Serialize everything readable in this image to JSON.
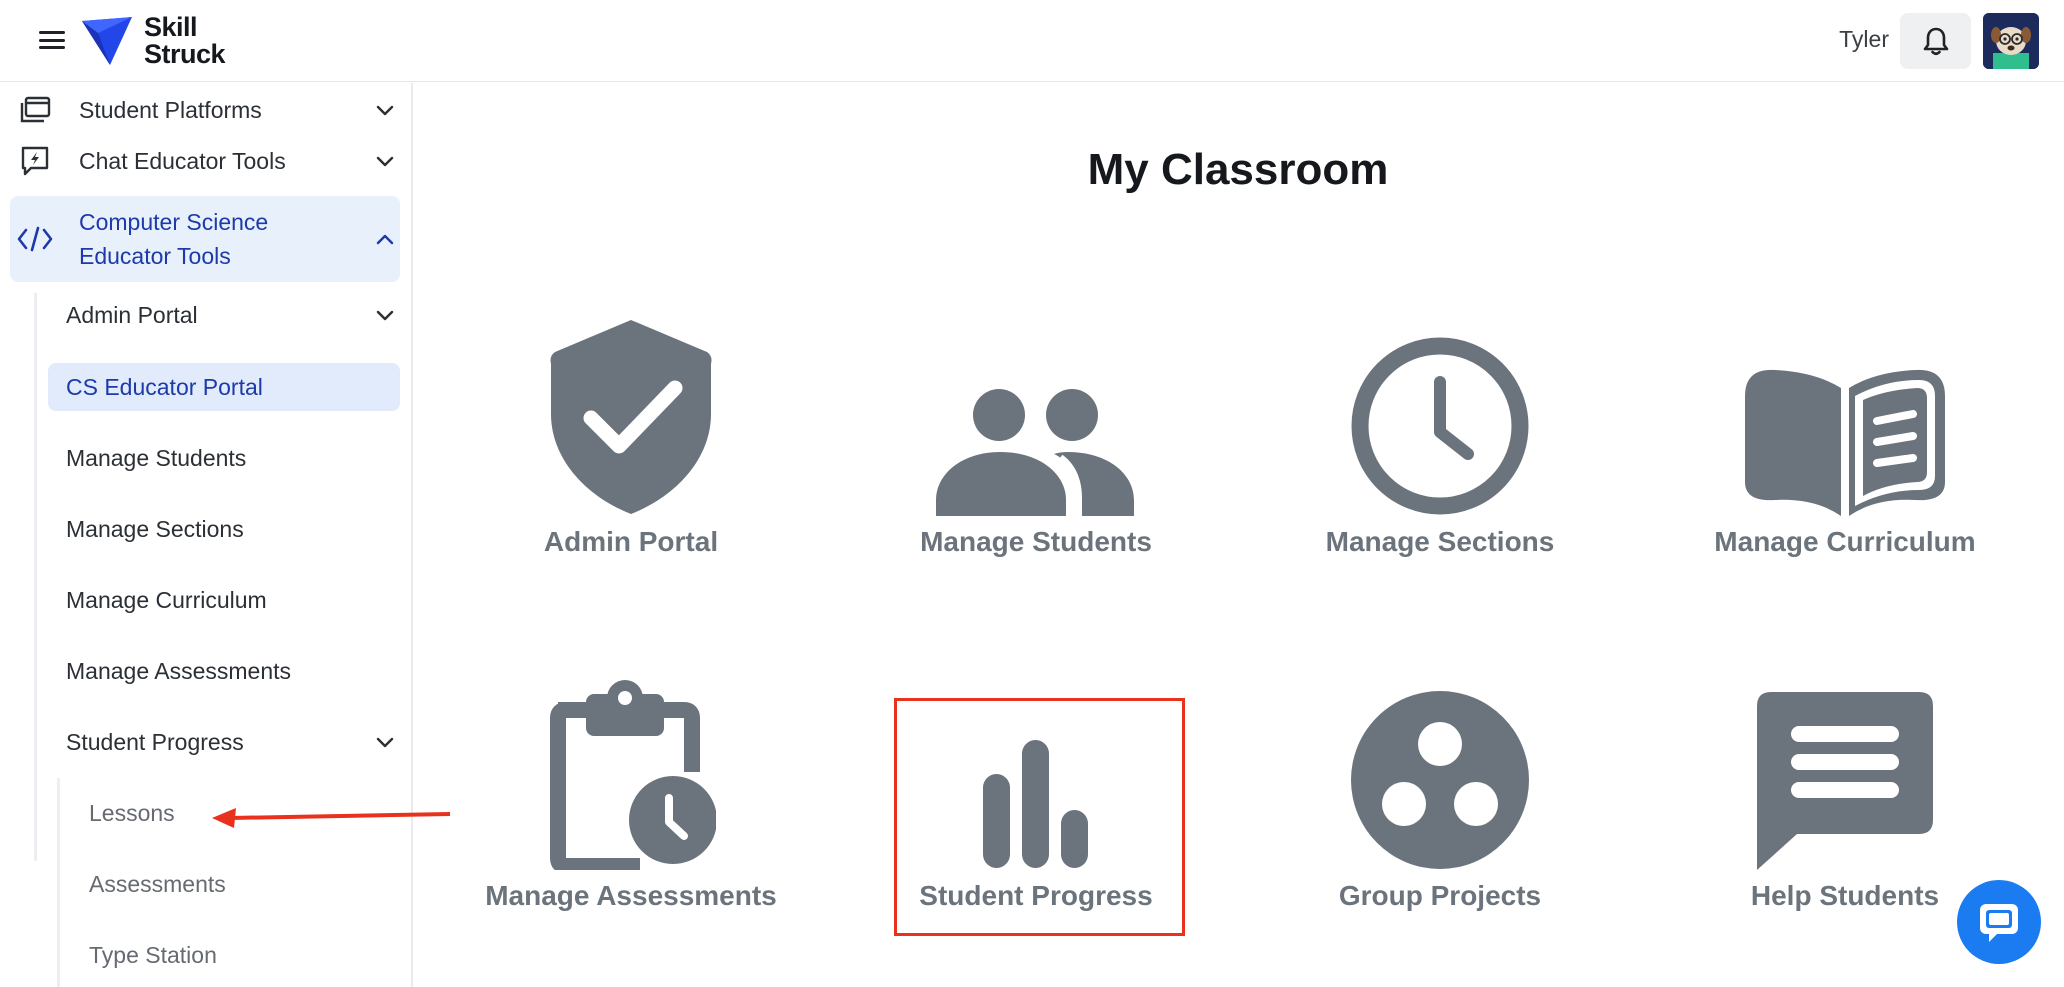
{
  "header": {
    "logo_line1": "Skill",
    "logo_line2": "Struck",
    "user_name": "Tyler"
  },
  "sidebar": {
    "items": [
      {
        "label": "Student Platforms",
        "icon": "platforms-icon"
      },
      {
        "label": "Chat Educator Tools",
        "icon": "chat-bolt-icon"
      },
      {
        "label": "Computer Science Educator Tools",
        "label_line1": "Computer Science",
        "label_line2": "Educator Tools",
        "icon": "code-icon",
        "expanded": true
      }
    ],
    "sub_items": [
      {
        "label": "Admin Portal",
        "has_chevron": true
      },
      {
        "label": "CS Educator Portal",
        "selected": true
      },
      {
        "label": "Manage Students"
      },
      {
        "label": "Manage Sections"
      },
      {
        "label": "Manage Curriculum"
      },
      {
        "label": "Manage Assessments"
      },
      {
        "label": "Student Progress",
        "has_chevron": true
      }
    ],
    "leaf_items": [
      {
        "label": "Lessons"
      },
      {
        "label": "Assessments"
      },
      {
        "label": "Type Station"
      }
    ]
  },
  "main": {
    "title": "My Classroom",
    "tiles": [
      {
        "label": "Admin Portal",
        "icon": "shield-check-icon"
      },
      {
        "label": "Manage Students",
        "icon": "group-icon"
      },
      {
        "label": "Manage Sections",
        "icon": "clock-icon"
      },
      {
        "label": "Manage Curriculum",
        "icon": "book-icon"
      },
      {
        "label": "Manage Assessments",
        "icon": "clipboard-clock-icon"
      },
      {
        "label": "Student Progress",
        "icon": "bar-chart-icon",
        "highlighted": true
      },
      {
        "label": "Group Projects",
        "icon": "circles-icon"
      },
      {
        "label": "Help Students",
        "icon": "message-icon"
      }
    ]
  },
  "colors": {
    "accent": "#1c3aa9",
    "active_bg": "#e8f0fc",
    "icon_gray": "#6b747c",
    "annotation_red": "#e8321d",
    "chat_blue": "#1b7cf1"
  }
}
